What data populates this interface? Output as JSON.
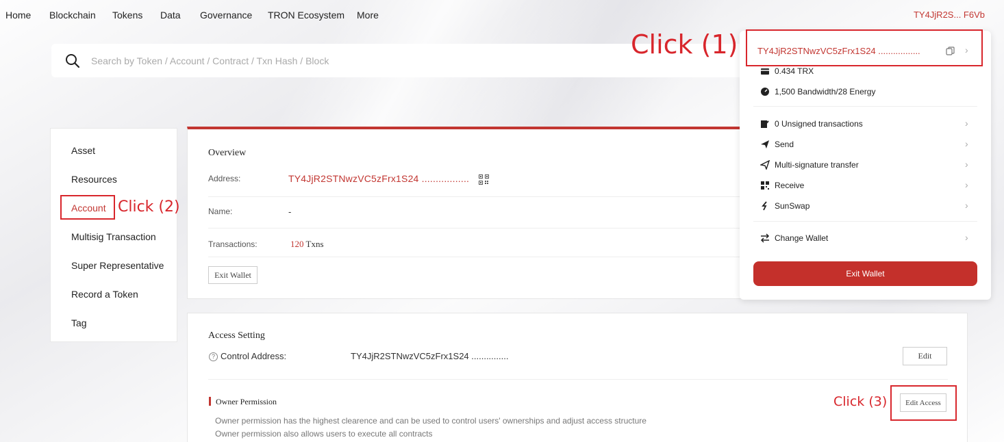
{
  "nav": {
    "items": [
      "Home",
      "Blockchain",
      "Tokens",
      "Data",
      "Governance",
      "TRON Ecosystem",
      "More"
    ],
    "wallet_short": "TY4JjR2S... F6Vb"
  },
  "search": {
    "placeholder": "Search by Token / Account / Contract / Txn Hash / Block"
  },
  "sidebar": {
    "items": [
      "Asset",
      "Resources",
      "Account",
      "Multisig Transaction",
      "Super Representative",
      "Record a Token",
      "Tag"
    ]
  },
  "annotations": {
    "click1": "Click (1)",
    "click2": "Click (2)",
    "click3": "Click (3)"
  },
  "overview": {
    "title": "Overview",
    "address_label": "Address:",
    "address_value": "TY4JjR2STNwzVC5zFrx1S24 .................",
    "name_label": "Name:",
    "name_value": "-",
    "transactions_label": "Transactions:",
    "transactions_count": "120",
    "transactions_unit": "Txns",
    "exit_button": "Exit Wallet"
  },
  "access": {
    "title": "Access Setting",
    "control_label": "Control Address:",
    "control_value": "TY4JjR2STNwzVC5zFrx1S24 ...............",
    "edit_button": "Edit",
    "owner_title": "Owner Permission",
    "owner_desc_1": "Owner permission has the highest clearence and can be used to control users' ownerships and adjust access structure",
    "owner_desc_2": "Owner permission also allows users to execute all contracts",
    "edit_access_button": "Edit Access"
  },
  "wallet": {
    "address": "TY4JjR2STNwzVC5zFrx1S24 .................",
    "trx": "0.434 TRX",
    "resources": "1,500 Bandwidth/28 Energy",
    "menu": [
      "0 Unsigned transactions",
      "Send",
      "Multi-signature transfer",
      "Receive",
      "SunSwap"
    ],
    "change_wallet": "Change Wallet",
    "exit_button": "Exit Wallet"
  },
  "colors": {
    "accent": "#c23631",
    "annotation": "#d8262c"
  }
}
